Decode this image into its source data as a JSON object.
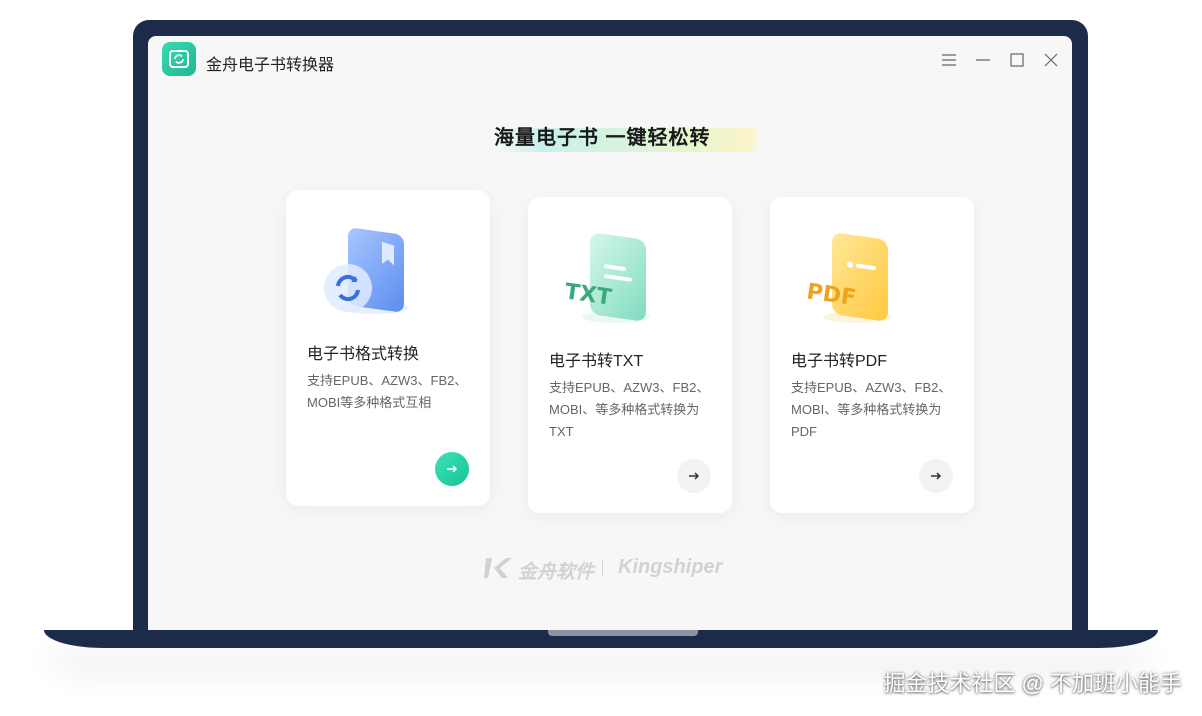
{
  "app": {
    "title": "金舟电子书转换器",
    "icon": "book-convert-logo-icon"
  },
  "window_controls": [
    {
      "name": "menu-icon"
    },
    {
      "name": "minimize-icon"
    },
    {
      "name": "maximize-icon"
    },
    {
      "name": "close-icon"
    }
  ],
  "headline": "海量电子书  一键轻松转",
  "cards": [
    {
      "title": "电子书格式转换",
      "description": "支持EPUB、AZW3、FB2、MOBI等多种格式互相",
      "icon": "book-convert-icon",
      "selected": true
    },
    {
      "title": "电子书转TXT",
      "description": "支持EPUB、AZW3、FB2、MOBI、等多种格式转换为TXT",
      "icon": "txt-file-icon",
      "icon_label": "TXT",
      "selected": false
    },
    {
      "title": "电子书转PDF",
      "description": "支持EPUB、AZW3、FB2、MOBI、等多种格式转换为PDF",
      "icon": "pdf-file-icon",
      "icon_label": "PDF",
      "selected": false
    }
  ],
  "brand": {
    "cn": "金舟软件",
    "en": "Kingshiper"
  },
  "watermark": "掘金技术社区 @ 不加班小能手",
  "colors": {
    "accent": "#1fc49b",
    "laptop_frame": "#1c2b4a",
    "window_bg": "#f7f7f7"
  }
}
